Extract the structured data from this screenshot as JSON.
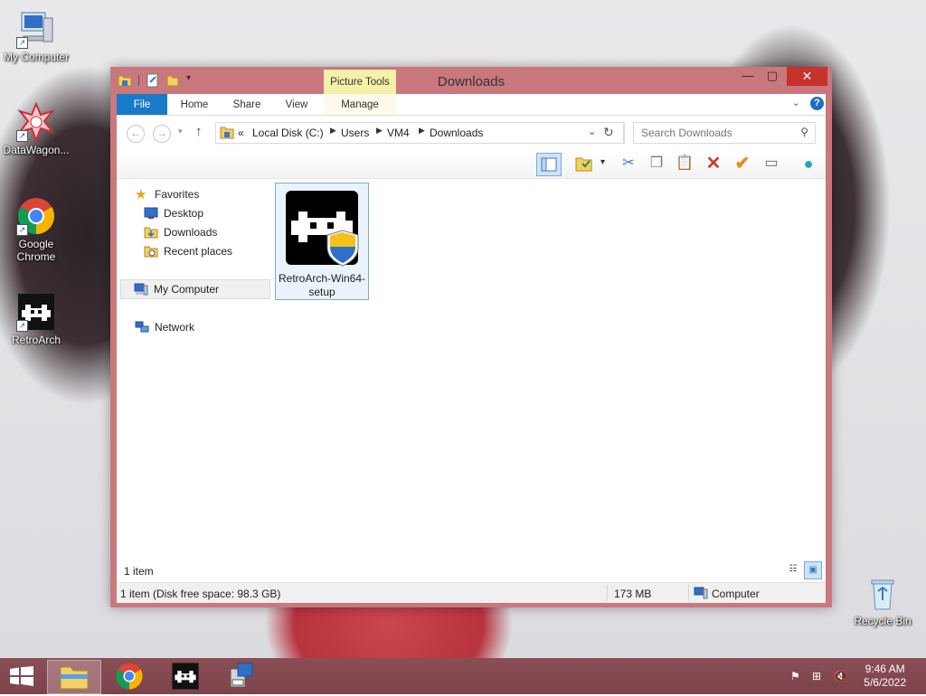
{
  "desktop": {
    "icons": [
      {
        "label": "My Computer"
      },
      {
        "label": "DataWagon..."
      },
      {
        "label": "Google Chrome"
      },
      {
        "label": "RetroArch"
      },
      {
        "label": "Recycle Bin"
      }
    ]
  },
  "window": {
    "title": "Downloads",
    "context_tab": "Picture Tools",
    "ribbon_tabs": [
      "File",
      "Home",
      "Share",
      "View",
      "Manage"
    ],
    "breadcrumb": {
      "overflow": "«",
      "parts": [
        "Local Disk (C:)",
        "Users",
        "VM4",
        "Downloads"
      ]
    },
    "search_placeholder": "Search Downloads",
    "nav_pane": {
      "favorites": "Favorites",
      "favorite_items": [
        "Desktop",
        "Downloads",
        "Recent places"
      ],
      "my_computer": "My Computer",
      "network": "Network"
    },
    "files": [
      {
        "name": "RetroArch-Win64-setup"
      }
    ],
    "item_count": "1 item",
    "status": {
      "left": "1 item (Disk free space: 98.3 GB)",
      "size": "173 MB",
      "location": "Computer"
    }
  },
  "taskbar": {
    "time": "9:46 AM",
    "date": "5/6/2022"
  },
  "colors": {
    "accent_blue": "#1979ca",
    "context_tab": "#f6f0a8",
    "window_frame": "#c9787d",
    "close": "#c7322a"
  }
}
